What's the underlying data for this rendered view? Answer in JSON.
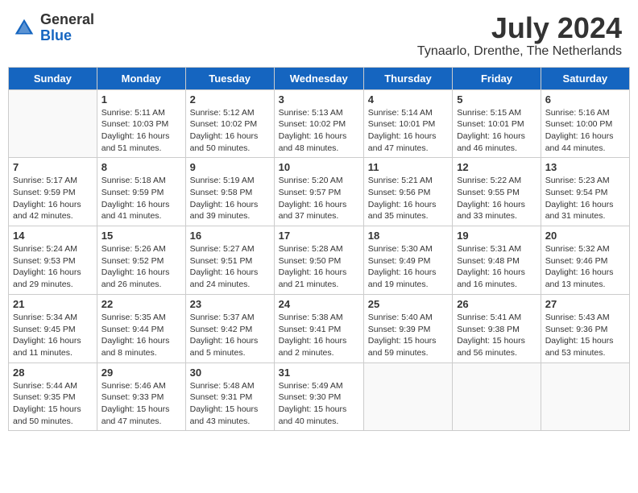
{
  "header": {
    "logo_general": "General",
    "logo_blue": "Blue",
    "month_year": "July 2024",
    "location": "Tynaarlo, Drenthe, The Netherlands"
  },
  "days_of_week": [
    "Sunday",
    "Monday",
    "Tuesday",
    "Wednesday",
    "Thursday",
    "Friday",
    "Saturday"
  ],
  "weeks": [
    [
      {
        "day": "",
        "info": ""
      },
      {
        "day": "1",
        "info": "Sunrise: 5:11 AM\nSunset: 10:03 PM\nDaylight: 16 hours\nand 51 minutes."
      },
      {
        "day": "2",
        "info": "Sunrise: 5:12 AM\nSunset: 10:02 PM\nDaylight: 16 hours\nand 50 minutes."
      },
      {
        "day": "3",
        "info": "Sunrise: 5:13 AM\nSunset: 10:02 PM\nDaylight: 16 hours\nand 48 minutes."
      },
      {
        "day": "4",
        "info": "Sunrise: 5:14 AM\nSunset: 10:01 PM\nDaylight: 16 hours\nand 47 minutes."
      },
      {
        "day": "5",
        "info": "Sunrise: 5:15 AM\nSunset: 10:01 PM\nDaylight: 16 hours\nand 46 minutes."
      },
      {
        "day": "6",
        "info": "Sunrise: 5:16 AM\nSunset: 10:00 PM\nDaylight: 16 hours\nand 44 minutes."
      }
    ],
    [
      {
        "day": "7",
        "info": "Sunrise: 5:17 AM\nSunset: 9:59 PM\nDaylight: 16 hours\nand 42 minutes."
      },
      {
        "day": "8",
        "info": "Sunrise: 5:18 AM\nSunset: 9:59 PM\nDaylight: 16 hours\nand 41 minutes."
      },
      {
        "day": "9",
        "info": "Sunrise: 5:19 AM\nSunset: 9:58 PM\nDaylight: 16 hours\nand 39 minutes."
      },
      {
        "day": "10",
        "info": "Sunrise: 5:20 AM\nSunset: 9:57 PM\nDaylight: 16 hours\nand 37 minutes."
      },
      {
        "day": "11",
        "info": "Sunrise: 5:21 AM\nSunset: 9:56 PM\nDaylight: 16 hours\nand 35 minutes."
      },
      {
        "day": "12",
        "info": "Sunrise: 5:22 AM\nSunset: 9:55 PM\nDaylight: 16 hours\nand 33 minutes."
      },
      {
        "day": "13",
        "info": "Sunrise: 5:23 AM\nSunset: 9:54 PM\nDaylight: 16 hours\nand 31 minutes."
      }
    ],
    [
      {
        "day": "14",
        "info": "Sunrise: 5:24 AM\nSunset: 9:53 PM\nDaylight: 16 hours\nand 29 minutes."
      },
      {
        "day": "15",
        "info": "Sunrise: 5:26 AM\nSunset: 9:52 PM\nDaylight: 16 hours\nand 26 minutes."
      },
      {
        "day": "16",
        "info": "Sunrise: 5:27 AM\nSunset: 9:51 PM\nDaylight: 16 hours\nand 24 minutes."
      },
      {
        "day": "17",
        "info": "Sunrise: 5:28 AM\nSunset: 9:50 PM\nDaylight: 16 hours\nand 21 minutes."
      },
      {
        "day": "18",
        "info": "Sunrise: 5:30 AM\nSunset: 9:49 PM\nDaylight: 16 hours\nand 19 minutes."
      },
      {
        "day": "19",
        "info": "Sunrise: 5:31 AM\nSunset: 9:48 PM\nDaylight: 16 hours\nand 16 minutes."
      },
      {
        "day": "20",
        "info": "Sunrise: 5:32 AM\nSunset: 9:46 PM\nDaylight: 16 hours\nand 13 minutes."
      }
    ],
    [
      {
        "day": "21",
        "info": "Sunrise: 5:34 AM\nSunset: 9:45 PM\nDaylight: 16 hours\nand 11 minutes."
      },
      {
        "day": "22",
        "info": "Sunrise: 5:35 AM\nSunset: 9:44 PM\nDaylight: 16 hours\nand 8 minutes."
      },
      {
        "day": "23",
        "info": "Sunrise: 5:37 AM\nSunset: 9:42 PM\nDaylight: 16 hours\nand 5 minutes."
      },
      {
        "day": "24",
        "info": "Sunrise: 5:38 AM\nSunset: 9:41 PM\nDaylight: 16 hours\nand 2 minutes."
      },
      {
        "day": "25",
        "info": "Sunrise: 5:40 AM\nSunset: 9:39 PM\nDaylight: 15 hours\nand 59 minutes."
      },
      {
        "day": "26",
        "info": "Sunrise: 5:41 AM\nSunset: 9:38 PM\nDaylight: 15 hours\nand 56 minutes."
      },
      {
        "day": "27",
        "info": "Sunrise: 5:43 AM\nSunset: 9:36 PM\nDaylight: 15 hours\nand 53 minutes."
      }
    ],
    [
      {
        "day": "28",
        "info": "Sunrise: 5:44 AM\nSunset: 9:35 PM\nDaylight: 15 hours\nand 50 minutes."
      },
      {
        "day": "29",
        "info": "Sunrise: 5:46 AM\nSunset: 9:33 PM\nDaylight: 15 hours\nand 47 minutes."
      },
      {
        "day": "30",
        "info": "Sunrise: 5:48 AM\nSunset: 9:31 PM\nDaylight: 15 hours\nand 43 minutes."
      },
      {
        "day": "31",
        "info": "Sunrise: 5:49 AM\nSunset: 9:30 PM\nDaylight: 15 hours\nand 40 minutes."
      },
      {
        "day": "",
        "info": ""
      },
      {
        "day": "",
        "info": ""
      },
      {
        "day": "",
        "info": ""
      }
    ]
  ]
}
